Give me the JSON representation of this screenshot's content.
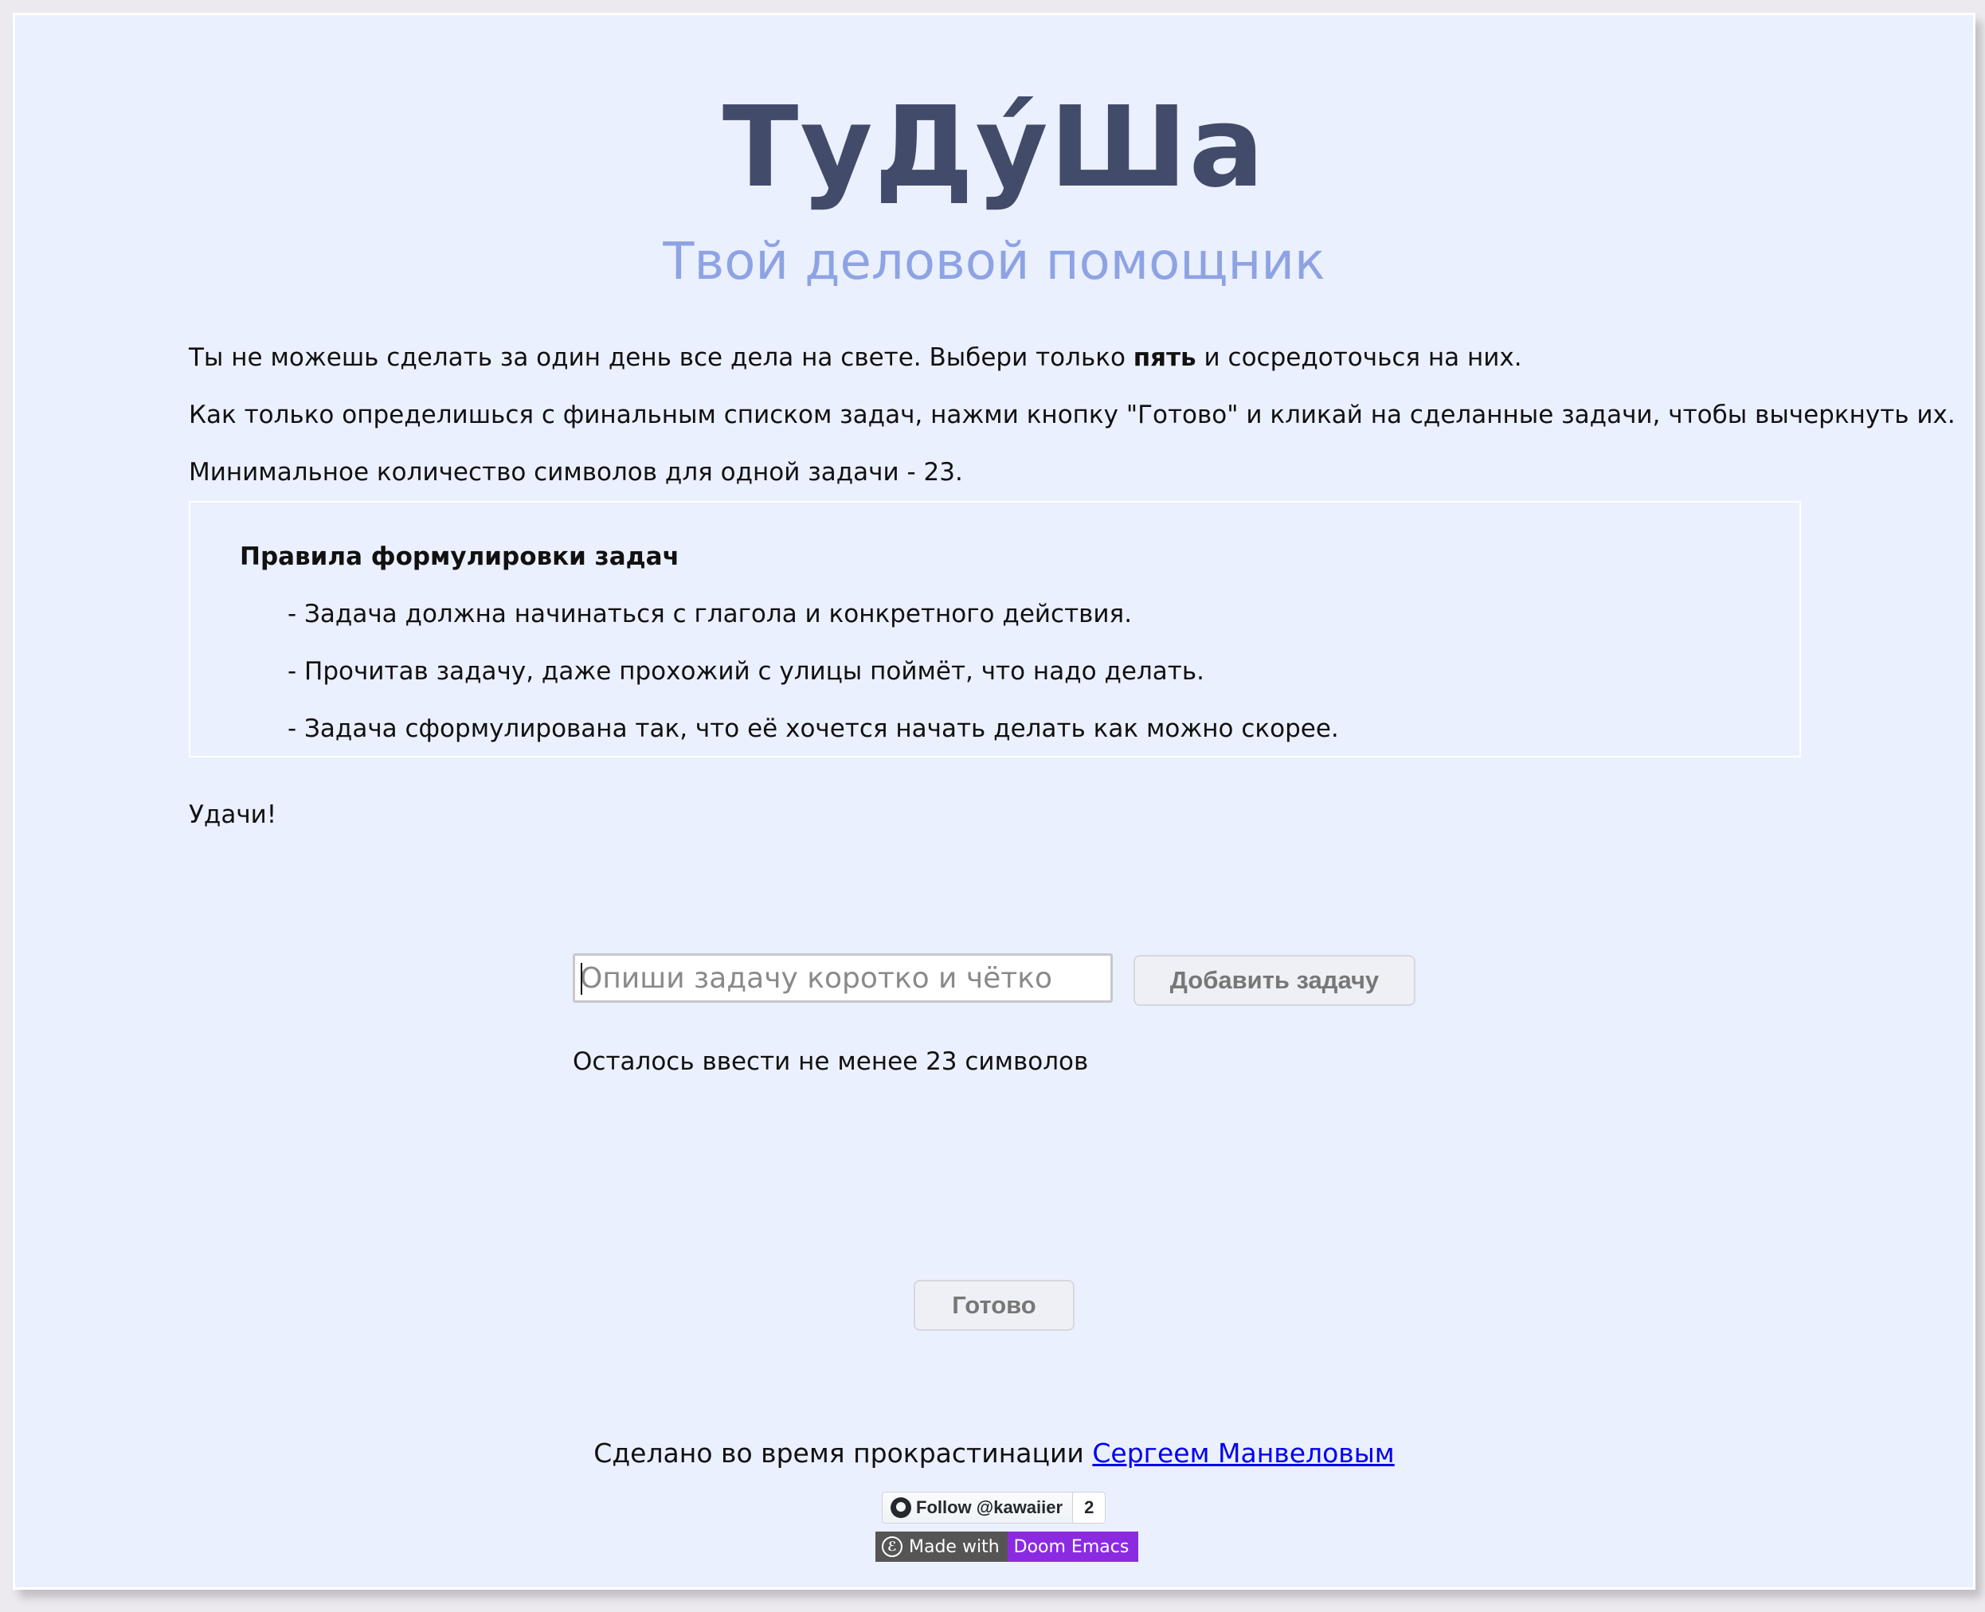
{
  "header": {
    "title": "ТуДу́Ша",
    "subtitle": "Твой деловой помощник"
  },
  "intro": {
    "line1_before": "Ты не можешь сделать за один день все дела на свете. Выбери только ",
    "line1_bold": "пять",
    "line1_after": " и сосредоточься на них.",
    "line2": "Как только определишься с финальным списком задач, нажми кнопку \"Готово\" и кликай на сделанные задачи, чтобы вычеркнуть их.",
    "line3": "Минимальное количество символов для одной задачи - 23."
  },
  "rules": {
    "title": "Правила формулировки задач",
    "items": [
      "- Задача должна начинаться с глагола и конкретного действия.",
      "- Прочитав задачу, даже прохожий с улицы поймёт, что надо делать.",
      "- Задача сформулирована так, что её хочется начать делать как можно скорее."
    ]
  },
  "closing": "Удачи!",
  "task_form": {
    "input_placeholder": "Опиши задачу коротко и чётко",
    "input_value": "",
    "add_label": "Добавить задачу",
    "remaining_text": "Осталось ввести не менее 23 символов"
  },
  "done_label": "Готово",
  "footer": {
    "text": "Сделано во время прокрастинации ",
    "author_link": "Сергеем Манвеловым",
    "github_badge": {
      "icon": "github-icon",
      "label": "Follow @kawaiier",
      "count": "2"
    },
    "emacs_badge": {
      "icon": "emacs-icon",
      "left": "Made with",
      "right": "Doom Emacs"
    }
  },
  "colors": {
    "page_bg": "#ebf0ff",
    "title": "#424b6a",
    "subtitle": "#8ea3e3",
    "link": "#0000ee",
    "emacs_accent": "#8a2be2"
  }
}
